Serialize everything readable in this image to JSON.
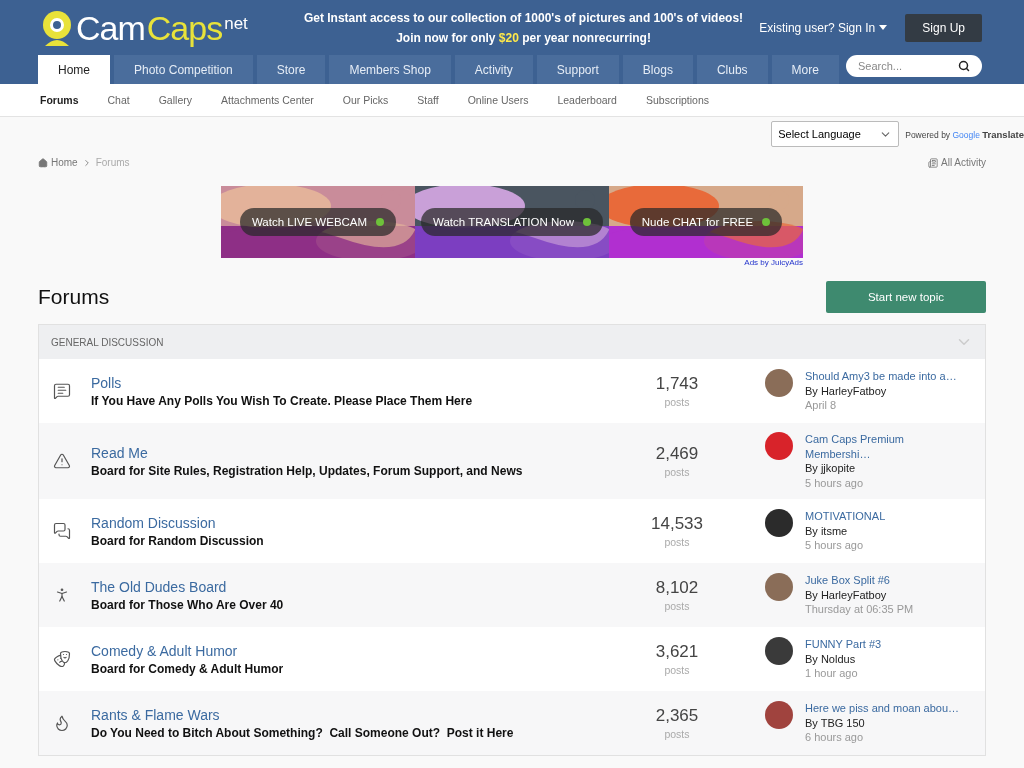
{
  "logo": {
    "first": "Cam",
    "second": "Caps",
    "suffix": "net"
  },
  "promo": {
    "line1": "Get Instant access to our collection of 1000's of pictures and 100's of videos!",
    "line2_before": "Join now for only ",
    "price": "$20",
    "line2_after": " per year nonrecurring!"
  },
  "account": {
    "sign_in": "Existing user? Sign In",
    "sign_up": "Sign Up"
  },
  "tabs": [
    {
      "label": "Home",
      "selected": true
    },
    {
      "label": "Photo Competition",
      "selected": false
    },
    {
      "label": "Store",
      "selected": false
    },
    {
      "label": "Members Shop",
      "selected": false
    },
    {
      "label": "Activity",
      "selected": false
    },
    {
      "label": "Support",
      "selected": false
    },
    {
      "label": "Blogs",
      "selected": false
    },
    {
      "label": "Clubs",
      "selected": false
    },
    {
      "label": "More",
      "selected": false
    }
  ],
  "search": {
    "placeholder": "Search..."
  },
  "subnav": [
    {
      "label": "Forums",
      "selected": true
    },
    {
      "label": "Chat",
      "selected": false
    },
    {
      "label": "Gallery",
      "selected": false
    },
    {
      "label": "Attachments Center",
      "selected": false
    },
    {
      "label": "Our Picks",
      "selected": false
    },
    {
      "label": "Staff",
      "selected": false
    },
    {
      "label": "Online Users",
      "selected": false
    },
    {
      "label": "Leaderboard",
      "selected": false
    },
    {
      "label": "Subscriptions",
      "selected": false
    }
  ],
  "translate": {
    "select": "Select Language",
    "powered": "Powered by",
    "google": "Google",
    "translate": "Translate"
  },
  "breadcrumb": [
    {
      "label": "Home"
    },
    {
      "label": "Forums"
    }
  ],
  "all_activity": "All Activity",
  "ads": {
    "panels": [
      {
        "label": "Watch LIVE WEBCAM"
      },
      {
        "label": "Watch TRANSLATION Now"
      },
      {
        "label": "Nude CHAT for FREE"
      }
    ],
    "credit": "Ads by JuicyAds"
  },
  "page_title": "Forums",
  "new_topic": "Start new topic",
  "section": {
    "title": "GENERAL DISCUSSION",
    "expanded": true
  },
  "forums": [
    {
      "name": "Polls",
      "description": "If You Have Any Polls You Wish To Create. Please Place Them Here",
      "count": "1,743",
      "unit": "posts",
      "last_title": "Should Amy3 be made into a…",
      "last_by": "By HarleyFatboy",
      "last_time": "April 8",
      "color": "#8a6d58"
    },
    {
      "name": "Read Me",
      "description": "Board for Site Rules, Registration Help, Updates, Forum Support, and News",
      "count": "2,469",
      "unit": "posts",
      "last_title": "Cam Caps Premium Membershi…",
      "last_by": "By jjkopite",
      "last_time": "5 hours ago",
      "color": "#d8232a"
    },
    {
      "name": "Random Discussion",
      "description": "Board for Random Discussion",
      "count": "14,533",
      "unit": "posts",
      "last_title": "MOTIVATIONAL",
      "last_by": "By itsme",
      "last_time": "5 hours ago",
      "color": "#2b2b2b"
    },
    {
      "name": "The Old Dudes Board",
      "description": "Board for Those Who Are Over 40",
      "count": "8,102",
      "unit": "posts",
      "last_title": "Juke Box Split #6",
      "last_by": "By HarleyFatboy",
      "last_time": "Thursday at 06:35 PM",
      "color": "#8a6d58"
    },
    {
      "name": "Comedy & Adult Humor",
      "description": "Board for Comedy & Adult Humor",
      "count": "3,621",
      "unit": "posts",
      "last_title": "FUNNY Part #3",
      "last_by": "By Noldus",
      "last_time": "1 hour ago",
      "color": "#3a3a3a"
    },
    {
      "name": "Rants & Flame Wars",
      "description": "Do You Need to Bitch About Something?  Call Someone Out?  Post it Here",
      "count": "2,365",
      "unit": "posts",
      "last_title": "Here we piss and moan abou…",
      "last_by": "By TBG 150",
      "last_time": "6 hours ago",
      "color": "#a0433e"
    }
  ]
}
